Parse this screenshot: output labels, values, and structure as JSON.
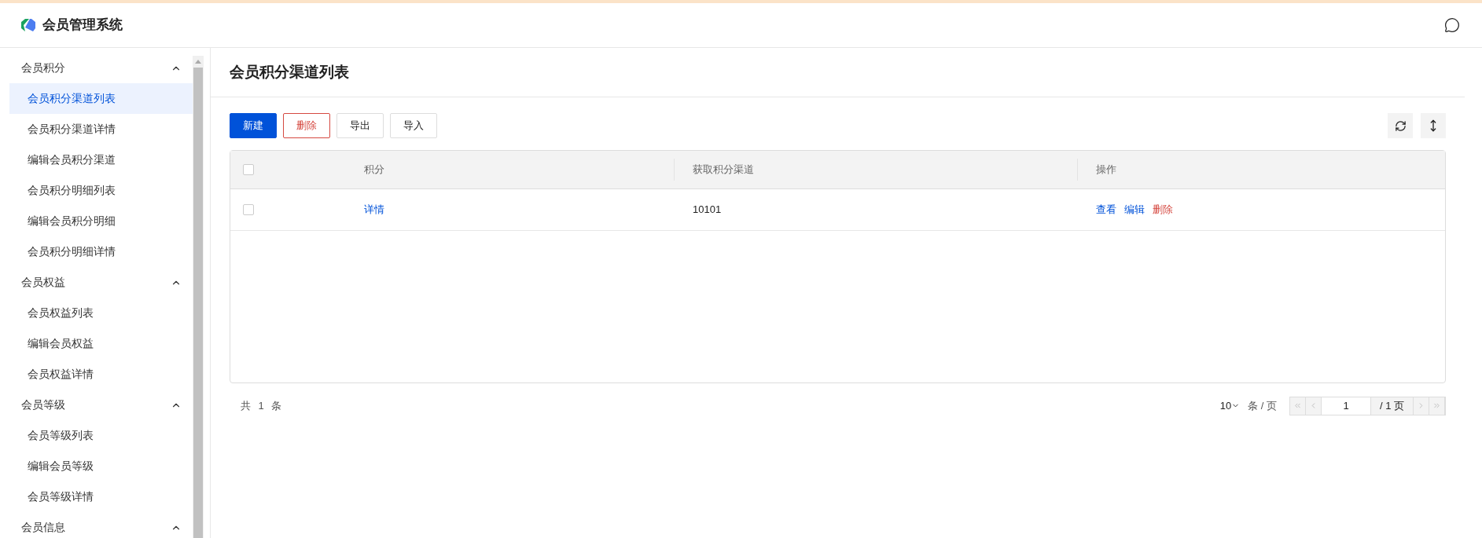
{
  "header": {
    "title": "会员管理系统"
  },
  "sidebar": {
    "groups": [
      {
        "label": "会员积分",
        "expanded": true,
        "items": [
          {
            "label": "会员积分渠道列表",
            "selected": true
          },
          {
            "label": "会员积分渠道详情",
            "selected": false
          },
          {
            "label": "编辑会员积分渠道",
            "selected": false
          },
          {
            "label": "会员积分明细列表",
            "selected": false
          },
          {
            "label": "编辑会员积分明细",
            "selected": false
          },
          {
            "label": "会员积分明细详情",
            "selected": false
          }
        ]
      },
      {
        "label": "会员权益",
        "expanded": true,
        "items": [
          {
            "label": "会员权益列表",
            "selected": false
          },
          {
            "label": "编辑会员权益",
            "selected": false
          },
          {
            "label": "会员权益详情",
            "selected": false
          }
        ]
      },
      {
        "label": "会员等级",
        "expanded": true,
        "items": [
          {
            "label": "会员等级列表",
            "selected": false
          },
          {
            "label": "编辑会员等级",
            "selected": false
          },
          {
            "label": "会员等级详情",
            "selected": false
          }
        ]
      },
      {
        "label": "会员信息",
        "expanded": true
      }
    ]
  },
  "page_title": "会员积分渠道列表",
  "toolbar": [
    {
      "label": "新建",
      "kind": "primary"
    },
    {
      "label": "删除",
      "kind": "danger"
    },
    {
      "label": "导出",
      "kind": "default"
    },
    {
      "label": "导入",
      "kind": "default"
    }
  ],
  "table": {
    "select_all_checked": false,
    "columns": [
      "积分",
      "获取积分渠道",
      "操作"
    ],
    "rows": [
      {
        "checked": false,
        "cells": [
          "详情",
          "10101"
        ],
        "actions": [
          {
            "label": "查看",
            "kind": "link"
          },
          {
            "label": "编辑",
            "kind": "link"
          },
          {
            "label": "删除",
            "kind": "danger"
          }
        ]
      }
    ]
  },
  "pagination": {
    "total": "共 1 条",
    "page_size": "10",
    "per_page": "条 / 页",
    "page": "1",
    "pages": "/ 1 页",
    "first_disabled": true,
    "prev_disabled": true,
    "next_disabled": true,
    "last_disabled": true
  }
}
